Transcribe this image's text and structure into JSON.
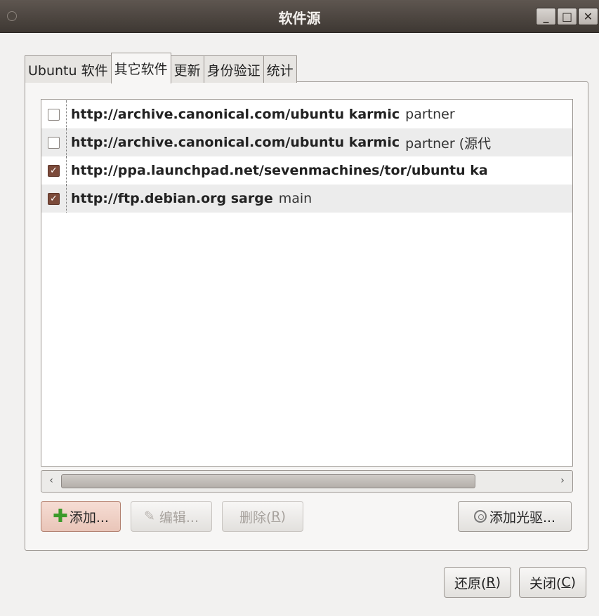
{
  "window": {
    "title": "软件源",
    "min_label": "_",
    "max_label": "□",
    "close_label": "✕"
  },
  "tabs": [
    {
      "label": "Ubuntu 软件",
      "active": false
    },
    {
      "label": "其它软件",
      "active": true
    },
    {
      "label": "更新",
      "active": false
    },
    {
      "label": "身份验证",
      "active": false
    },
    {
      "label": "统计",
      "active": false
    }
  ],
  "sources": [
    {
      "checked": false,
      "url": "http://archive.canonical.com/ubuntu karmic",
      "components": "partner"
    },
    {
      "checked": false,
      "url": "http://archive.canonical.com/ubuntu karmic",
      "components": "partner (源代"
    },
    {
      "checked": true,
      "url": "http://ppa.launchpad.net/sevenmachines/tor/ubuntu ka",
      "components": ""
    },
    {
      "checked": true,
      "url": "http://ftp.debian.org sarge",
      "components": "main"
    }
  ],
  "scroll": {
    "left": "‹",
    "right": "›"
  },
  "buttons": {
    "add": "添加...",
    "edit": "编辑...",
    "delete_prefix": "删除(",
    "delete_key": "R",
    "delete_suffix": ")",
    "add_cdrom": "添加光驱...",
    "revert_prefix": "还原(",
    "revert_key": "R",
    "revert_suffix": ")",
    "close_prefix": "关闭(",
    "close_key": "C",
    "close_suffix": ")"
  },
  "colors": {
    "titlebar": "#3e3833",
    "checked": "#7b4a3a",
    "add_plus": "#3c9a2a"
  }
}
